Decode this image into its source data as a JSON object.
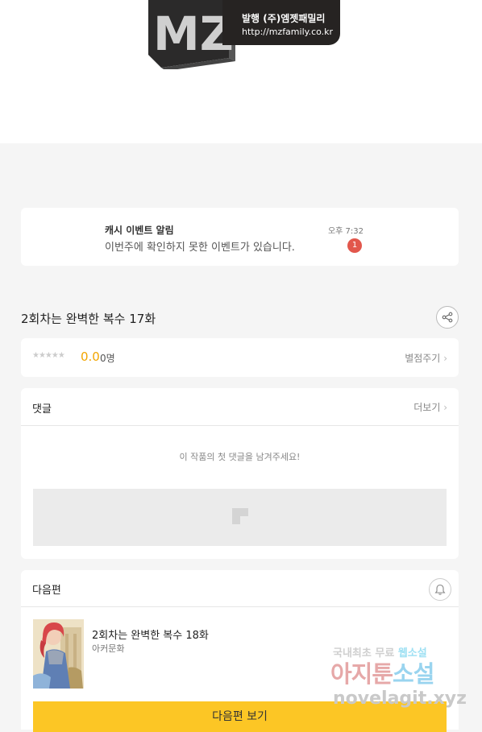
{
  "banner": {
    "logo_letters": "MZ",
    "publisher": "발행 (주)엠젯패밀리",
    "website": "http://mzfamily.co.kr"
  },
  "notification": {
    "title": "캐시 이벤트 알림",
    "message": "이번주에 확인하지 못한 이벤트가 있습니다.",
    "time": "오후 7:32",
    "badge_count": "1"
  },
  "episode": {
    "title": "2회차는 완벽한 복수 17화",
    "share_icon": "share-icon"
  },
  "rating": {
    "stars": "★★★★★",
    "score": "0.0",
    "participants": "0명",
    "rate_link": "별점주기",
    "rating_value": 0
  },
  "comments": {
    "title": "댓글",
    "more_link": "더보기",
    "empty_message": "이 작품의 첫 댓글을 남겨주세요!"
  },
  "next_episode": {
    "section_title": "다음편",
    "title": "2회차는 완벽한 복수 18화",
    "author": "아커문화",
    "button_label": "다음편 보기",
    "bell_icon": "bell-icon"
  },
  "watermark": {
    "line1_prefix": "국내최초 무료 ",
    "line1_highlight": "웹소설",
    "line2_prefix": "아지툰",
    "line2_highlight": "소설",
    "line3": "novelagit.xyz"
  },
  "colors": {
    "accent_yellow": "#fcc625",
    "score_orange": "#f2a500",
    "badge_red": "#e2574c"
  }
}
